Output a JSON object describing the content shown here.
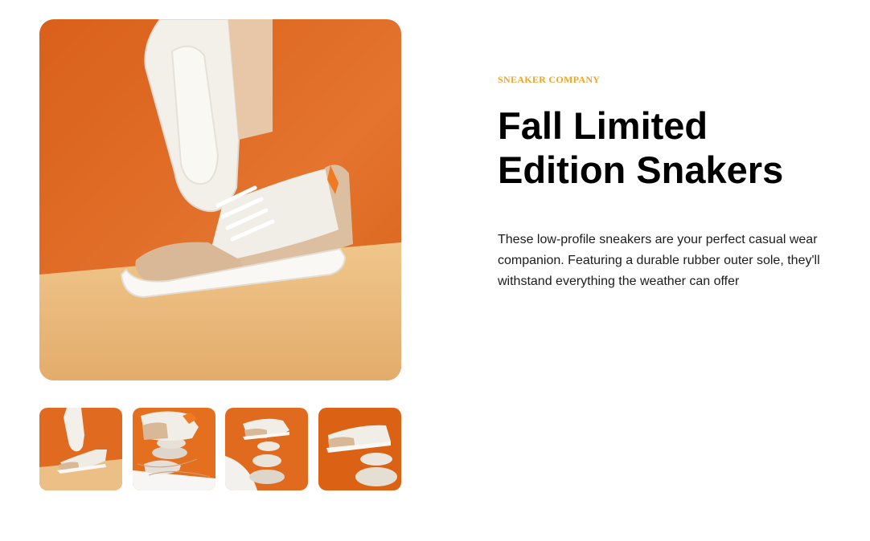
{
  "product": {
    "brand": "SNEAKER COMPANY",
    "title": "Fall Limited Edition Snakers",
    "description": "These low-profile sneakers are your perfect casual wear companion. Featuring a durable rubber outer sole, they'll withstand everything the weather can offer"
  },
  "gallery": {
    "thumbnail_count": 4
  },
  "colors": {
    "accent": "#f0a52a",
    "orange_background": "#e06a1e",
    "beige_floor": "#e9b77a"
  }
}
